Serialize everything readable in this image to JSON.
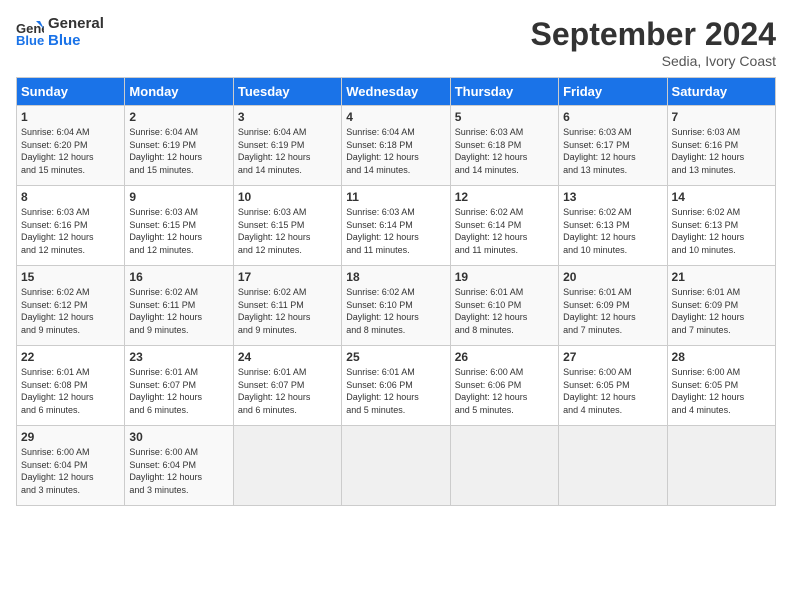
{
  "header": {
    "logo_line1": "General",
    "logo_line2": "Blue",
    "month": "September 2024",
    "location": "Sedia, Ivory Coast"
  },
  "weekdays": [
    "Sunday",
    "Monday",
    "Tuesday",
    "Wednesday",
    "Thursday",
    "Friday",
    "Saturday"
  ],
  "weeks": [
    [
      {
        "day": "1",
        "info": "Sunrise: 6:04 AM\nSunset: 6:20 PM\nDaylight: 12 hours\nand 15 minutes."
      },
      {
        "day": "2",
        "info": "Sunrise: 6:04 AM\nSunset: 6:19 PM\nDaylight: 12 hours\nand 15 minutes."
      },
      {
        "day": "3",
        "info": "Sunrise: 6:04 AM\nSunset: 6:19 PM\nDaylight: 12 hours\nand 14 minutes."
      },
      {
        "day": "4",
        "info": "Sunrise: 6:04 AM\nSunset: 6:18 PM\nDaylight: 12 hours\nand 14 minutes."
      },
      {
        "day": "5",
        "info": "Sunrise: 6:03 AM\nSunset: 6:18 PM\nDaylight: 12 hours\nand 14 minutes."
      },
      {
        "day": "6",
        "info": "Sunrise: 6:03 AM\nSunset: 6:17 PM\nDaylight: 12 hours\nand 13 minutes."
      },
      {
        "day": "7",
        "info": "Sunrise: 6:03 AM\nSunset: 6:16 PM\nDaylight: 12 hours\nand 13 minutes."
      }
    ],
    [
      {
        "day": "8",
        "info": "Sunrise: 6:03 AM\nSunset: 6:16 PM\nDaylight: 12 hours\nand 12 minutes."
      },
      {
        "day": "9",
        "info": "Sunrise: 6:03 AM\nSunset: 6:15 PM\nDaylight: 12 hours\nand 12 minutes."
      },
      {
        "day": "10",
        "info": "Sunrise: 6:03 AM\nSunset: 6:15 PM\nDaylight: 12 hours\nand 12 minutes."
      },
      {
        "day": "11",
        "info": "Sunrise: 6:03 AM\nSunset: 6:14 PM\nDaylight: 12 hours\nand 11 minutes."
      },
      {
        "day": "12",
        "info": "Sunrise: 6:02 AM\nSunset: 6:14 PM\nDaylight: 12 hours\nand 11 minutes."
      },
      {
        "day": "13",
        "info": "Sunrise: 6:02 AM\nSunset: 6:13 PM\nDaylight: 12 hours\nand 10 minutes."
      },
      {
        "day": "14",
        "info": "Sunrise: 6:02 AM\nSunset: 6:13 PM\nDaylight: 12 hours\nand 10 minutes."
      }
    ],
    [
      {
        "day": "15",
        "info": "Sunrise: 6:02 AM\nSunset: 6:12 PM\nDaylight: 12 hours\nand 9 minutes."
      },
      {
        "day": "16",
        "info": "Sunrise: 6:02 AM\nSunset: 6:11 PM\nDaylight: 12 hours\nand 9 minutes."
      },
      {
        "day": "17",
        "info": "Sunrise: 6:02 AM\nSunset: 6:11 PM\nDaylight: 12 hours\nand 9 minutes."
      },
      {
        "day": "18",
        "info": "Sunrise: 6:02 AM\nSunset: 6:10 PM\nDaylight: 12 hours\nand 8 minutes."
      },
      {
        "day": "19",
        "info": "Sunrise: 6:01 AM\nSunset: 6:10 PM\nDaylight: 12 hours\nand 8 minutes."
      },
      {
        "day": "20",
        "info": "Sunrise: 6:01 AM\nSunset: 6:09 PM\nDaylight: 12 hours\nand 7 minutes."
      },
      {
        "day": "21",
        "info": "Sunrise: 6:01 AM\nSunset: 6:09 PM\nDaylight: 12 hours\nand 7 minutes."
      }
    ],
    [
      {
        "day": "22",
        "info": "Sunrise: 6:01 AM\nSunset: 6:08 PM\nDaylight: 12 hours\nand 6 minutes."
      },
      {
        "day": "23",
        "info": "Sunrise: 6:01 AM\nSunset: 6:07 PM\nDaylight: 12 hours\nand 6 minutes."
      },
      {
        "day": "24",
        "info": "Sunrise: 6:01 AM\nSunset: 6:07 PM\nDaylight: 12 hours\nand 6 minutes."
      },
      {
        "day": "25",
        "info": "Sunrise: 6:01 AM\nSunset: 6:06 PM\nDaylight: 12 hours\nand 5 minutes."
      },
      {
        "day": "26",
        "info": "Sunrise: 6:00 AM\nSunset: 6:06 PM\nDaylight: 12 hours\nand 5 minutes."
      },
      {
        "day": "27",
        "info": "Sunrise: 6:00 AM\nSunset: 6:05 PM\nDaylight: 12 hours\nand 4 minutes."
      },
      {
        "day": "28",
        "info": "Sunrise: 6:00 AM\nSunset: 6:05 PM\nDaylight: 12 hours\nand 4 minutes."
      }
    ],
    [
      {
        "day": "29",
        "info": "Sunrise: 6:00 AM\nSunset: 6:04 PM\nDaylight: 12 hours\nand 3 minutes."
      },
      {
        "day": "30",
        "info": "Sunrise: 6:00 AM\nSunset: 6:04 PM\nDaylight: 12 hours\nand 3 minutes."
      },
      {
        "day": "",
        "info": ""
      },
      {
        "day": "",
        "info": ""
      },
      {
        "day": "",
        "info": ""
      },
      {
        "day": "",
        "info": ""
      },
      {
        "day": "",
        "info": ""
      }
    ]
  ]
}
